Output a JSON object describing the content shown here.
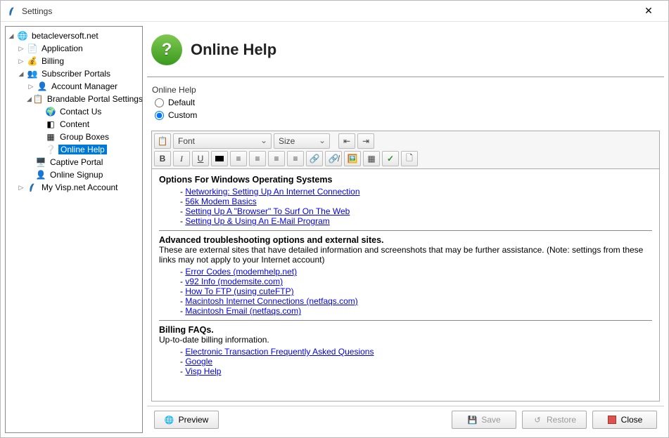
{
  "window": {
    "title": "Settings"
  },
  "tree": {
    "root": "betacleversoft.net",
    "nodes": {
      "application": "Application",
      "billing": "Billing",
      "subscriber_portals": "Subscriber Portals",
      "account_manager": "Account Manager",
      "brandable_portal_settings": "Brandable Portal Settings",
      "contact_us": "Contact Us",
      "content": "Content",
      "group_boxes": "Group Boxes",
      "online_help": "Online Help",
      "captive_portal": "Captive Portal",
      "online_signup": "Online Signup",
      "my_visp_account": "My Visp.net Account"
    }
  },
  "page": {
    "title": "Online Help",
    "group_label": "Online Help",
    "radio_default": "Default",
    "radio_custom": "Custom",
    "radio_selected": "custom"
  },
  "toolbar": {
    "font_placeholder": "Font",
    "size_placeholder": "Size"
  },
  "content": {
    "sections": [
      {
        "heading": "Options For Windows Operating Systems",
        "subtitle": "",
        "links": [
          "Networking: Setting Up An Internet Connection",
          "56k Modem Basics",
          "Setting Up A \"Browser\" To Surf On The Web",
          "Setting Up & Using An E-Mail Program"
        ]
      },
      {
        "heading": "Advanced troubleshooting options and external sites.",
        "subtitle": "These are external sites that have detailed information and screenshots that may be further assistance. (Note: settings from these links may not apply to your Internet account)",
        "links": [
          "Error Codes (modemhelp.net)",
          "v92 Info (modemsite.com)",
          "How To FTP (using cuteFTP)",
          "Macintosh Internet Connections (netfaqs.com)",
          "Macintosh Email (netfaqs.com)"
        ]
      },
      {
        "heading": "Billing FAQs.",
        "subtitle": "Up-to-date billing information.",
        "links": [
          "Electronic Transaction Frequently Asked Quesions ",
          "Google ",
          "Visp Help"
        ]
      }
    ]
  },
  "footer": {
    "preview": "Preview",
    "save": "Save",
    "restore": "Restore",
    "close": "Close"
  }
}
